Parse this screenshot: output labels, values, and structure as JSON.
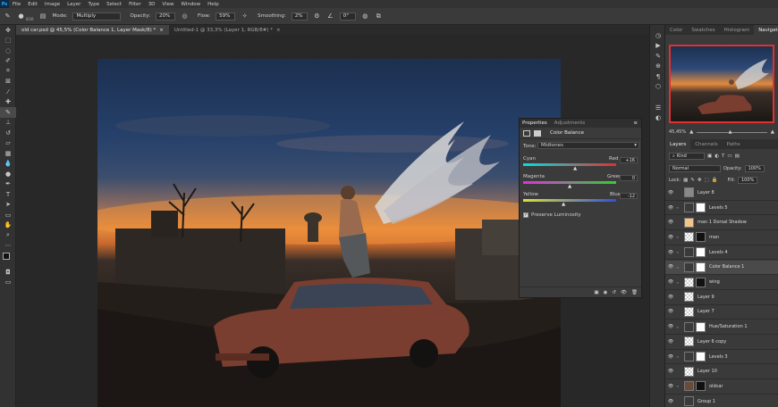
{
  "menu": {
    "app_icon": "Ps",
    "items": [
      "File",
      "Edit",
      "Image",
      "Layer",
      "Type",
      "Select",
      "Filter",
      "3D",
      "View",
      "Window",
      "Help"
    ]
  },
  "options": {
    "brush_size": "830",
    "mode_label": "Mode:",
    "mode_value": "Multiply",
    "opacity_label": "Opacity:",
    "opacity_value": "20%",
    "flow_label": "Flow:",
    "flow_value": "59%",
    "smoothing_label": "Smoothing:",
    "smoothing_value": "2%",
    "angle_value": "0°"
  },
  "tabs": [
    {
      "label": "old car.psd @ 45,5% (Color Balance 1, Layer Mask/8) *",
      "active": true
    },
    {
      "label": "Untitled-1 @ 33,3% (Layer 1, RGB/8#) *",
      "active": false
    }
  ],
  "properties": {
    "tab_properties": "Properties",
    "tab_adjustments": "Adjustments",
    "title": "Color Balance",
    "tone_label": "Tone:",
    "tone_value": "Midtones",
    "cyan": "Cyan",
    "red": "Red",
    "cyan_red_value": "+16",
    "magenta": "Magenta",
    "green": "Green",
    "magenta_green_value": "0",
    "yellow": "Yellow",
    "blue": "Blue",
    "yellow_blue_value": "-12",
    "preserve_luminosity": "Preserve Luminosity"
  },
  "right_top": {
    "tabs": [
      "Color",
      "Swatches",
      "Histogram",
      "Navigator"
    ],
    "active_tab": "Navigator",
    "zoom": "45,45%"
  },
  "layers_panel": {
    "tabs": [
      "Layers",
      "Channels",
      "Paths"
    ],
    "kind_label": "Kind",
    "blend_mode": "Normal",
    "opacity_label": "Opacity:",
    "opacity_value": "100%",
    "lock_label": "Lock:",
    "fill_label": "Fill:",
    "fill_value": "100%",
    "layers": [
      {
        "name": "Layer 8",
        "thumb": "gray",
        "mask": false
      },
      {
        "name": "Levels 5",
        "thumb": "adj",
        "mask": true
      },
      {
        "name": "man 1 Dorsal Shadow",
        "thumb": "skin",
        "mask": false
      },
      {
        "name": "man",
        "thumb": "checker",
        "mask": true
      },
      {
        "name": "Levels 4",
        "thumb": "adj",
        "mask": true
      },
      {
        "name": "Color Balance 1",
        "thumb": "adj",
        "mask": true
      },
      {
        "name": "wing",
        "thumb": "checker",
        "mask": true
      },
      {
        "name": "Layer 9",
        "thumb": "checker",
        "mask": false
      },
      {
        "name": "Layer 7",
        "thumb": "checker",
        "mask": false
      },
      {
        "name": "Hue/Saturation 1",
        "thumb": "adj",
        "mask": true
      },
      {
        "name": "Layer 6 copy",
        "thumb": "checker",
        "mask": false
      },
      {
        "name": "Levels 3",
        "thumb": "adj",
        "mask": true
      },
      {
        "name": "Layer 10",
        "thumb": "checker",
        "mask": false
      },
      {
        "name": "oldcar",
        "thumb": "car",
        "mask": true
      },
      {
        "name": "Group 1",
        "thumb": "folder",
        "mask": false
      }
    ]
  },
  "colors": {
    "accent": "#31a8ff",
    "nav_frame": "#e03030"
  }
}
